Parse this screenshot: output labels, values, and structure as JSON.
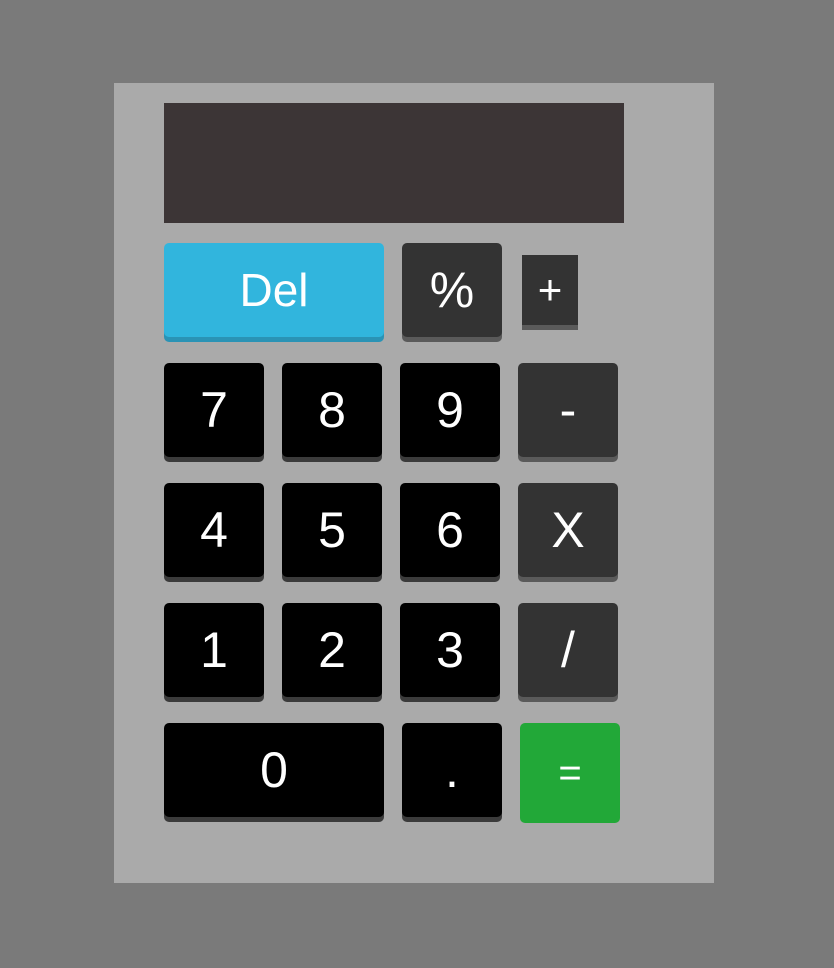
{
  "display": {
    "value": ""
  },
  "keys": {
    "del": "Del",
    "percent": "%",
    "plus": "+",
    "seven": "7",
    "eight": "8",
    "nine": "9",
    "minus": "-",
    "four": "4",
    "five": "5",
    "six": "6",
    "multiply": "X",
    "one": "1",
    "two": "2",
    "three": "3",
    "divide": "/",
    "zero": "0",
    "dot": ".",
    "equals": "="
  },
  "colors": {
    "background": "#7a7a7a",
    "body": "#aaaaaa",
    "display": "#3c3536",
    "number_key": "#000000",
    "operator_key": "#333333",
    "delete_key": "#31b5dd",
    "equals_key": "#22a838"
  }
}
